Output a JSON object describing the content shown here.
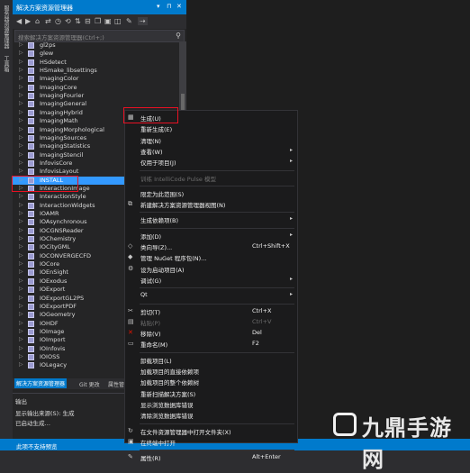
{
  "left_strip": {
    "text1": "服务器资源管理器",
    "text2": "工具箱"
  },
  "panel": {
    "title": "解决方案资源管理器",
    "title_buttons": [
      "▾",
      "⊓",
      "✕"
    ],
    "search_placeholder": "搜索解决方案资源管理器(Ctrl+;)",
    "tree": [
      "gl2ps",
      "glew",
      "HSdetect",
      "HSmake_libsettings",
      "ImagingColor",
      "ImagingCore",
      "ImagingFourier",
      "ImagingGeneral",
      "ImagingHybrid",
      "ImagingMath",
      "ImagingMorphological",
      "ImagingSources",
      "ImagingStatistics",
      "ImagingStencil",
      "InfovisCore",
      "InfovisLayout",
      "INSTALL",
      "InteractionImage",
      "InteractionStyle",
      "InteractionWidgets",
      "IOAMR",
      "IOAsynchronous",
      "IOCGNSReader",
      "IOChemistry",
      "IOCityGML",
      "IOCONVERGECFD",
      "IOCore",
      "IOEnSight",
      "IOExodus",
      "IOExport",
      "IOExportGL2PS",
      "IOExportPDF",
      "IOGeometry",
      "IOHDF",
      "IOImage",
      "IOImport",
      "IOInfovis",
      "IOIOSS",
      "IOLegacy"
    ],
    "selected": "INSTALL"
  },
  "tabs": [
    "解决方案资源管理器",
    "Git 更改",
    "属性管理器"
  ],
  "output": {
    "header": "输出",
    "source": "显示输出来源(S): 生成",
    "line": "已启动生成…"
  },
  "status": "此项不支持预览",
  "context_menu": [
    {
      "label": "生成(U)",
      "icon": "build-icon"
    },
    {
      "label": "重新生成(E)"
    },
    {
      "label": "清理(N)"
    },
    {
      "label": "查看(W)",
      "submenu": true
    },
    {
      "label": "仅用于项目(J)",
      "submenu": true
    },
    {
      "sep": true
    },
    {
      "label": "训练 IntelliCode Pulse 模型",
      "disabled": true
    },
    {
      "sep": true
    },
    {
      "label": "限定为此范围(S)"
    },
    {
      "label": "新建解决方案资源管理器视图(N)",
      "icon": "new-view-icon"
    },
    {
      "sep": true
    },
    {
      "label": "生成依赖项(B)",
      "submenu": true
    },
    {
      "sep": true
    },
    {
      "label": "添加(D)",
      "submenu": true
    },
    {
      "label": "类向导(Z)...",
      "shortcut": "Ctrl+Shift+X",
      "icon": "class-wizard-icon"
    },
    {
      "label": "管理 NuGet 程序包(N)...",
      "icon": "nuget-icon"
    },
    {
      "label": "设为启动项目(A)",
      "icon": "gear-icon"
    },
    {
      "label": "调试(G)",
      "submenu": true
    },
    {
      "sep": true
    },
    {
      "label": "Qt",
      "submenu": true
    },
    {
      "sep": true
    },
    {
      "label": "剪切(T)",
      "shortcut": "Ctrl+X",
      "icon": "cut-icon"
    },
    {
      "label": "粘贴(P)",
      "shortcut": "Ctrl+V",
      "disabled": true,
      "icon": "paste-icon"
    },
    {
      "label": "移除(V)",
      "shortcut": "Del",
      "icon": "remove-icon"
    },
    {
      "label": "重命名(M)",
      "shortcut": "F2",
      "icon": "rename-icon"
    },
    {
      "sep": true
    },
    {
      "label": "卸载项目(L)"
    },
    {
      "label": "加载项目的直接依赖项"
    },
    {
      "label": "加载项目的整个依赖树"
    },
    {
      "label": "重新扫描解决方案(S)"
    },
    {
      "label": "显示浏览数据库错误"
    },
    {
      "label": "清除浏览数据库错误"
    },
    {
      "sep": true
    },
    {
      "label": "在文件资源管理器中打开文件夹(X)",
      "icon": "open-folder-icon"
    },
    {
      "label": "在终端中打开",
      "icon": "terminal-icon"
    },
    {
      "sep": true
    },
    {
      "label": "属性(R)",
      "shortcut": "Alt+Enter",
      "icon": "wrench-icon"
    }
  ],
  "watermark": "九鼎手游网",
  "colors": {
    "accent": "#007acc",
    "highlight": "#e81123",
    "selection": "#3399ff"
  }
}
